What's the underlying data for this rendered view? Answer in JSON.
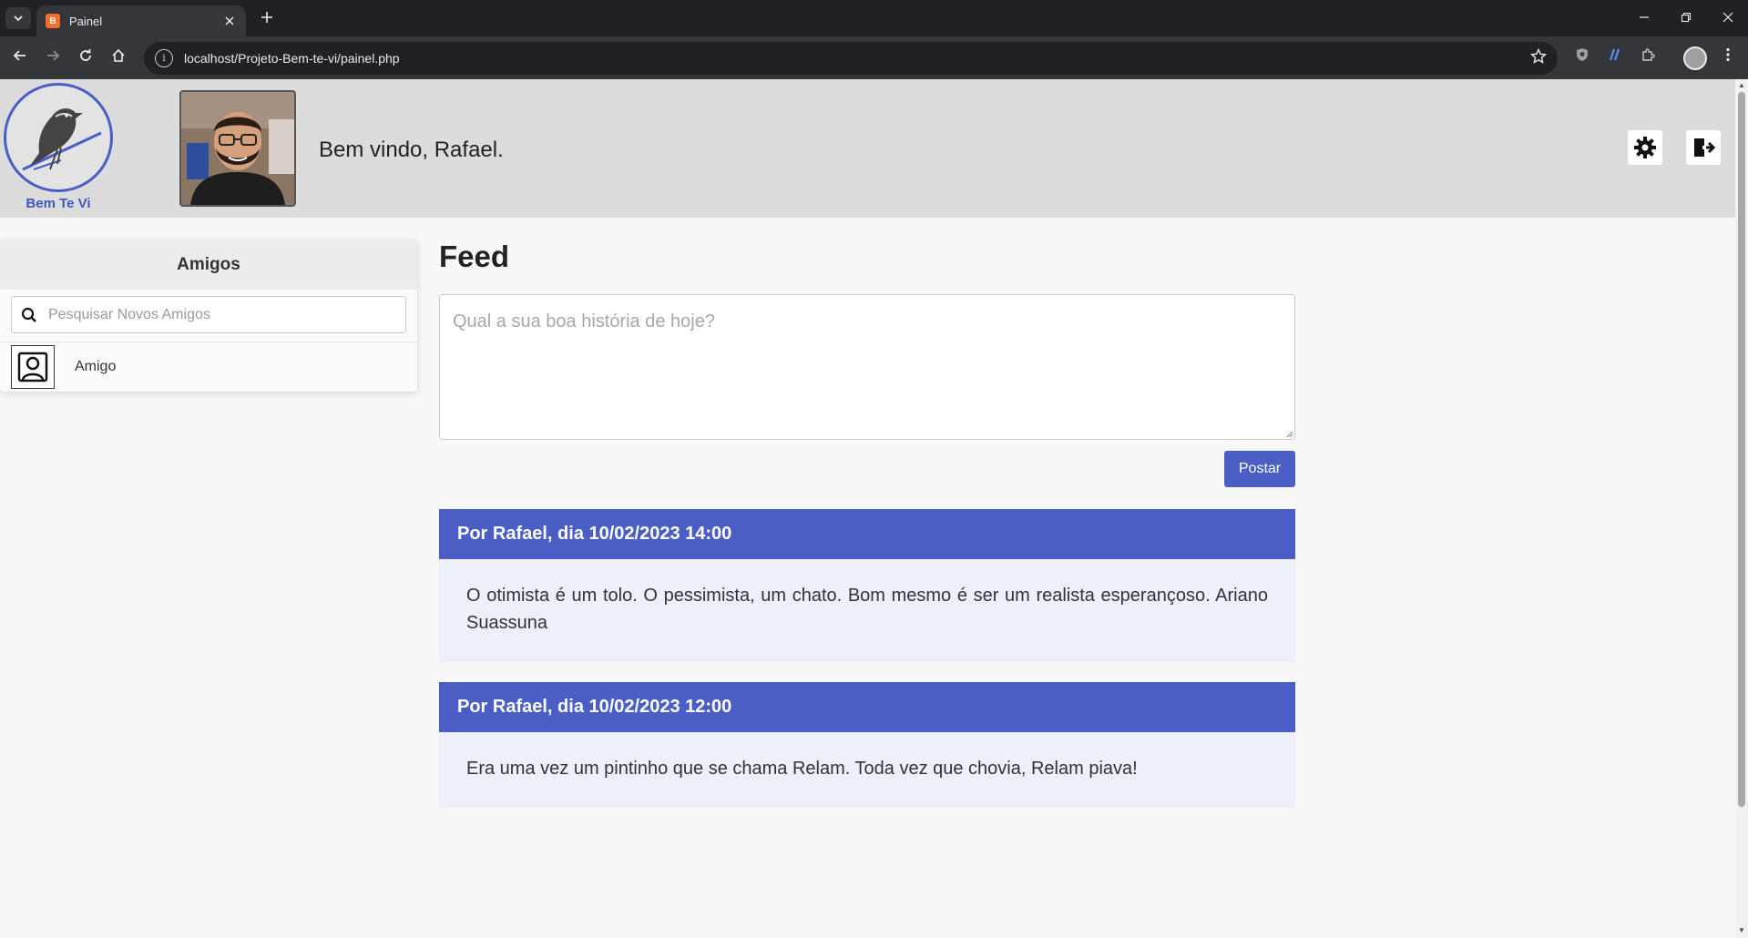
{
  "browser": {
    "tab_title": "Painel",
    "tab_favicon_glyph": "B",
    "url": "localhost/Projeto-Bem-te-vi/painel.php",
    "icons": {
      "tab_search": "chevron-down-icon",
      "close_tab": "close-icon",
      "new_tab": "plus-icon",
      "back": "arrow-left-icon",
      "forward": "arrow-right-icon",
      "reload": "reload-icon",
      "home": "home-icon",
      "bookmark": "star-icon",
      "extensions": "puzzle-icon",
      "menu": "kebab-menu-icon"
    },
    "colors": {
      "tab_strip": "#202124",
      "toolbar": "#35363a"
    }
  },
  "header": {
    "logo_text": "Bem Te Vi",
    "welcome": "Bem vindo, Rafael.",
    "settings_icon": "gear-icon",
    "logout_icon": "logout-icon"
  },
  "sidebar": {
    "title": "Amigos",
    "search_placeholder": "Pesquisar Novos Amigos",
    "friends": [
      {
        "name": "Amigo",
        "icon": "user-portrait-icon"
      }
    ]
  },
  "feed": {
    "title": "Feed",
    "composer_placeholder": "Qual a sua boa história de hoje?",
    "post_button": "Postar",
    "posts": [
      {
        "header": "Por Rafael, dia 10/02/2023 14:00",
        "body": "O otimista é um tolo. O pessimista, um chato. Bom mesmo é ser um realista esperançoso. Ariano Suassuna"
      },
      {
        "header": "Por Rafael, dia 10/02/2023 12:00",
        "body": "Era uma vez um pintinho que se chama Relam. Toda vez que chovia, Relam piava!"
      }
    ]
  },
  "colors": {
    "accent": "#4a5ec6",
    "header_bg": "#dcdcdc",
    "post_body_bg": "#edf0f9",
    "page_bg": "#f8f8f8"
  }
}
